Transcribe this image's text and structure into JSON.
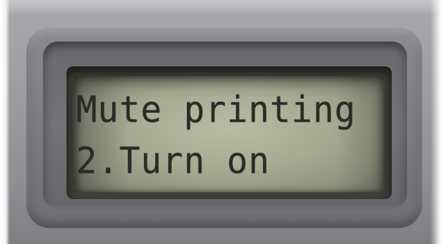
{
  "display": {
    "line_1": "Mute printing",
    "line_2": "2.Turn on"
  },
  "colors": {
    "lcd_background": "#a6ab93",
    "lcd_text": "#2a2b27",
    "bezel": "#7b7a7e"
  }
}
